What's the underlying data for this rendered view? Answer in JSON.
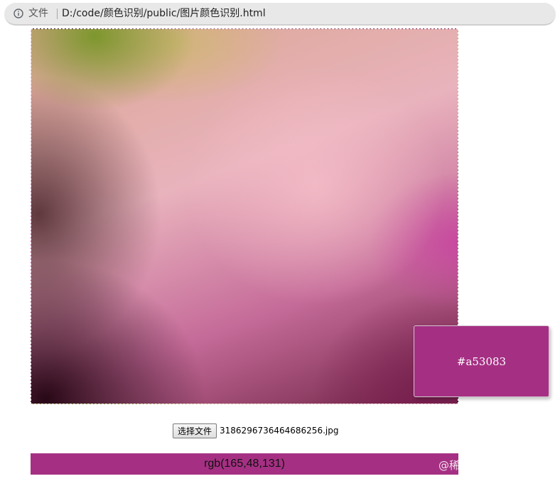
{
  "browser": {
    "protocol_label": "文件",
    "url": "D:/code/颜色识别/public/图片颜色识别.html",
    "info_icon": "info-icon"
  },
  "preview": {
    "detected_hex": "#a53083",
    "swatch_color": "#a53083"
  },
  "file_input": {
    "button_label": "选择文件",
    "file_name": "3186296736464686256.jpg"
  },
  "result": {
    "rgb_text": "rgb(165,48,131)",
    "bar_color": "#a53083"
  },
  "watermark": {
    "text": "@稀土掘金技术社区"
  }
}
